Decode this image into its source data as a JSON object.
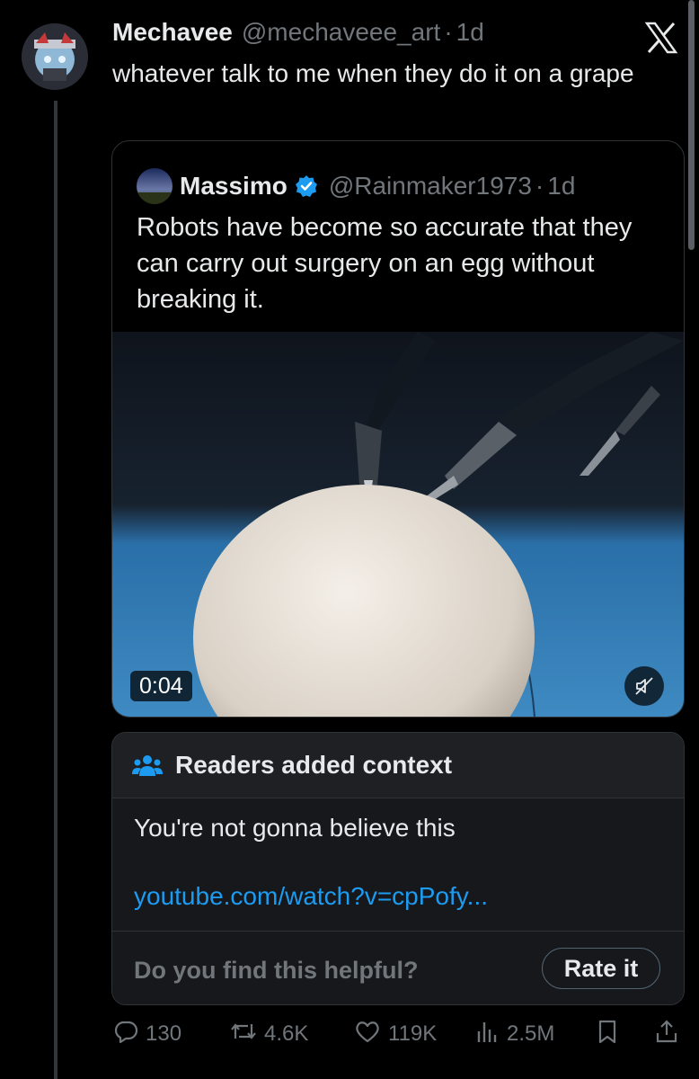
{
  "tweet": {
    "author_name": "Mechavee",
    "author_handle": "@mechaveee_art",
    "separator": "·",
    "time": "1d",
    "text": "whatever talk to me when they do it on a grape"
  },
  "quote": {
    "author_name": "Massimo",
    "author_handle": "@Rainmaker1973",
    "separator": "·",
    "time": "1d",
    "text": "Robots have become so accurate that they can carry out surgery on an egg without breaking it.",
    "video_duration": "0:04",
    "verified_color": "#1d9bf0"
  },
  "community_note": {
    "title": "Readers added context",
    "body": "You're not gonna believe this",
    "link": "youtube.com/watch?v=cpPofy...",
    "prompt": "Do you find this helpful?",
    "rate_label": "Rate it"
  },
  "actions": {
    "replies": "130",
    "reposts": "4.6K",
    "likes": "119K",
    "views": "2.5M"
  },
  "icons": [
    "x-logo-icon",
    "verified-badge-icon",
    "mute-icon",
    "people-icon",
    "reply-icon",
    "repost-icon",
    "like-icon",
    "views-icon",
    "bookmark-icon",
    "share-icon"
  ],
  "colors": {
    "background": "#000000",
    "link": "#1d9bf0",
    "muted": "#71767b"
  }
}
